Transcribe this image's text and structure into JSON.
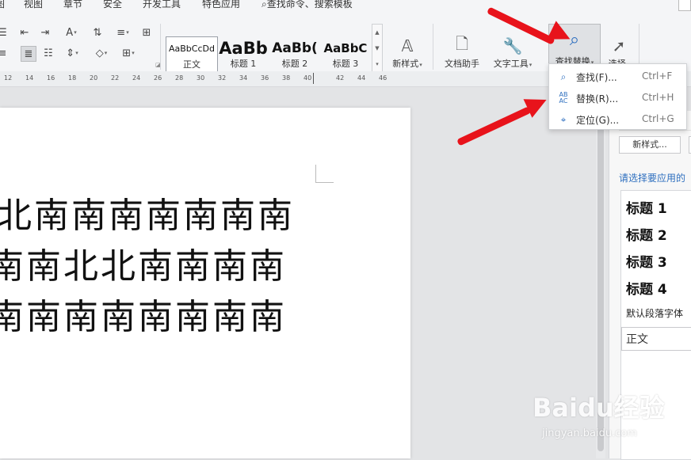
{
  "menu": {
    "items": [
      "视图",
      "章节",
      "安全",
      "开发工具",
      "特色应用"
    ],
    "search_label": "查找命令、搜索模板"
  },
  "styles": [
    {
      "preview": "AaBbCcDd",
      "label": "正文"
    },
    {
      "preview": "AaBb",
      "label": "标题 1"
    },
    {
      "preview": "AaBb(",
      "label": "标题 2"
    },
    {
      "preview": "AaBbC",
      "label": "标题 3"
    }
  ],
  "ribbon": {
    "new_style": "新样式",
    "doc_helper": "文档助手",
    "text_tools": "文字工具",
    "find_replace": "查找替换",
    "select": "选择"
  },
  "ruler": {
    "ticks": [
      "12",
      "14",
      "16",
      "18",
      "20",
      "22",
      "24",
      "26",
      "28",
      "30",
      "32",
      "34",
      "36",
      "38",
      "40",
      "42",
      "44",
      "46"
    ]
  },
  "document": {
    "lines": [
      "北南南南南南南南",
      "南南北北南南南南",
      "南南南南南南南南"
    ]
  },
  "dropdown": {
    "items": [
      {
        "label": "查找(F)...",
        "shortcut": "Ctrl+F",
        "icon": "search-icon"
      },
      {
        "label": "替换(R)...",
        "shortcut": "Ctrl+H",
        "icon": "replace-icon"
      },
      {
        "label": "定位(G)...",
        "shortcut": "Ctrl+G",
        "icon": "goto-icon"
      }
    ]
  },
  "panel": {
    "new_style_button": "新样式...",
    "hint": "请选择要应用的",
    "headings": [
      "标题 1",
      "标题 2",
      "标题 3",
      "标题 4"
    ],
    "default_font": "默认段落字体",
    "normal": "正文"
  },
  "watermark": {
    "logo": "Baidu经验",
    "url": "jingyan.baidu.com"
  },
  "colors": {
    "accent": "#2e6fbf",
    "arrow": "#e8131b"
  }
}
